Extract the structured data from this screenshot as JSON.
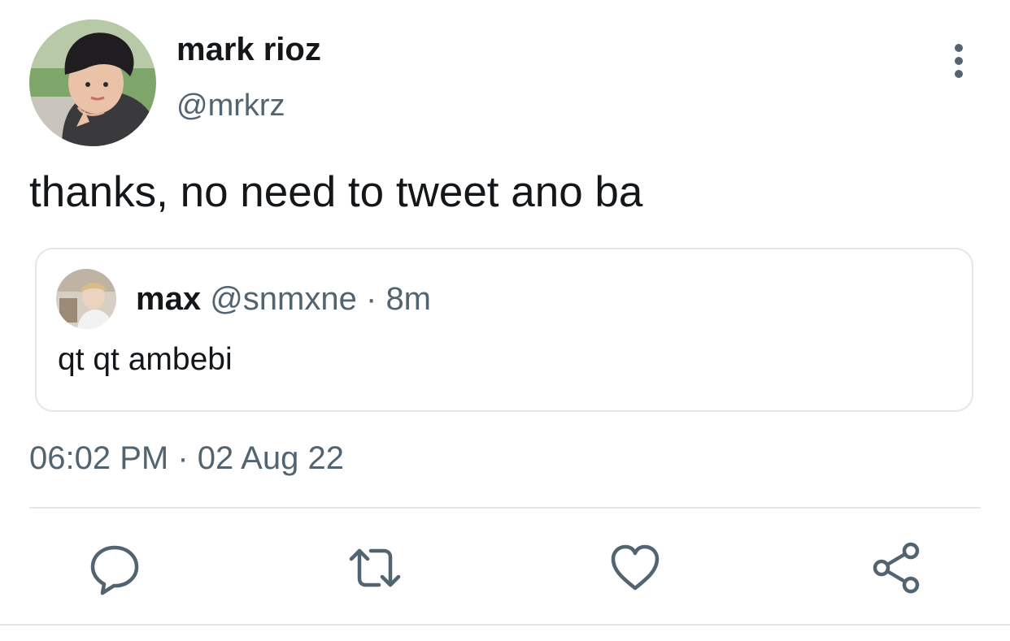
{
  "tweet": {
    "author": {
      "display_name": "mark rioz",
      "handle": "@mrkrz"
    },
    "text": "thanks, no need to tweet ano ba",
    "quoted": {
      "display_name": "max",
      "handle": "@snmxne",
      "separator": "·",
      "time": "8m",
      "text": "qt qt ambebi"
    },
    "timestamp": "06:02 PM · 02 Aug 22"
  },
  "icons": {
    "more": "more-vertical-icon",
    "reply": "reply-icon",
    "retweet": "retweet-icon",
    "like": "heart-icon",
    "share": "share-icon"
  },
  "colors": {
    "text": "#14171a",
    "secondary": "#536471",
    "border": "#e1e8ed"
  }
}
